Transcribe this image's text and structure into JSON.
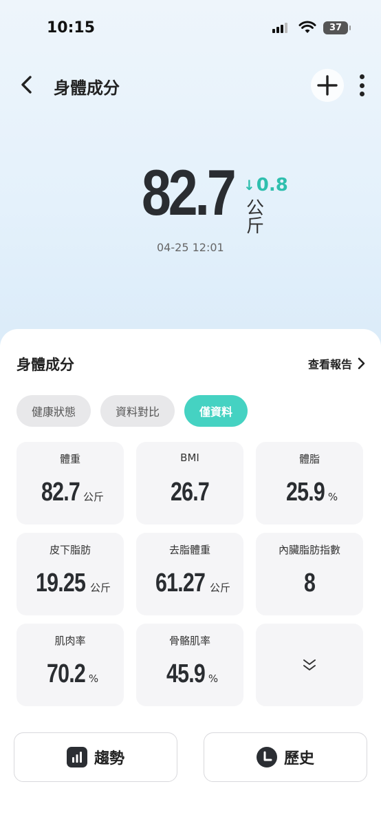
{
  "status": {
    "time": "10:15",
    "battery": "37"
  },
  "header": {
    "title": "身體成分"
  },
  "hero": {
    "value": "82.7",
    "delta": "0.8",
    "unit": "公斤",
    "date": "04-25 12:01"
  },
  "panel": {
    "title": "身體成分",
    "report_link": "查看報告",
    "tabs": [
      {
        "label": "健康狀態",
        "active": false
      },
      {
        "label": "資料對比",
        "active": false
      },
      {
        "label": "僅資料",
        "active": true
      }
    ],
    "metrics": [
      {
        "label": "體重",
        "value": "82.7",
        "unit": "公斤"
      },
      {
        "label": "BMI",
        "value": "26.7",
        "unit": ""
      },
      {
        "label": "體脂",
        "value": "25.9",
        "unit": "%"
      },
      {
        "label": "皮下脂肪",
        "value": "19.25",
        "unit": "公斤"
      },
      {
        "label": "去脂體重",
        "value": "61.27",
        "unit": "公斤"
      },
      {
        "label": "內臟脂肪指數",
        "value": "8",
        "unit": ""
      },
      {
        "label": "肌肉率",
        "value": "70.2",
        "unit": "%"
      },
      {
        "label": "骨骼肌率",
        "value": "45.9",
        "unit": "%"
      }
    ]
  },
  "buttons": {
    "trend": "趨勢",
    "history": "歷史"
  },
  "colors": {
    "accent": "#45d2c2",
    "delta": "#2fbfae",
    "text_dark": "#2a2d31"
  }
}
